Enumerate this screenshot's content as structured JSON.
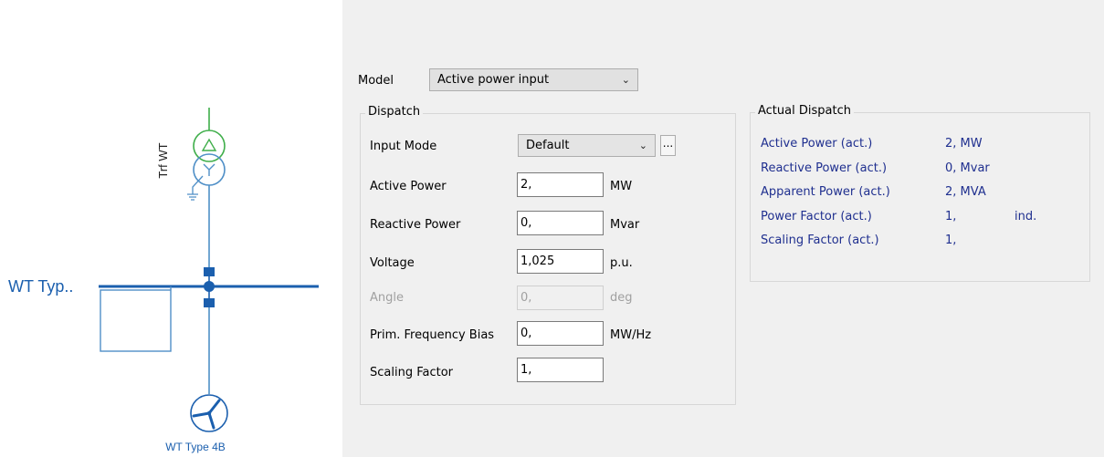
{
  "diagram": {
    "transformer_label": "Trf WT",
    "busbar_label": "WT Typ..",
    "generator_label": "WT Type 4B",
    "colors": {
      "line": "#4f8fc7",
      "busbar": "#1b5fae",
      "transformer_hv": "#3fae4a",
      "transformer_lv": "#4f8fc7"
    }
  },
  "model": {
    "label": "Model",
    "value": "Active power input"
  },
  "dispatch": {
    "title": "Dispatch",
    "input_mode": {
      "label": "Input Mode",
      "value": "Default",
      "browse": "..."
    },
    "active_power": {
      "label": "Active Power",
      "value": "2,",
      "unit": "MW"
    },
    "reactive_power": {
      "label": "Reactive Power",
      "value": "0,",
      "unit": "Mvar"
    },
    "voltage": {
      "label": "Voltage",
      "value": "1,025",
      "unit": "p.u."
    },
    "angle": {
      "label": "Angle",
      "value": "0,",
      "unit": "deg"
    },
    "freq_bias": {
      "label": "Prim. Frequency Bias",
      "value": "0,",
      "unit": "MW/Hz"
    },
    "scaling": {
      "label": "Scaling Factor",
      "value": "1,"
    }
  },
  "actual": {
    "title": "Actual Dispatch",
    "rows": [
      {
        "label": "Active Power (act.)",
        "value": "2, MW",
        "extra": ""
      },
      {
        "label": "Reactive Power (act.)",
        "value": "0, Mvar",
        "extra": ""
      },
      {
        "label": "Apparent Power (act.)",
        "value": "2, MVA",
        "extra": ""
      },
      {
        "label": "Power Factor (act.)",
        "value": "1,",
        "extra": "ind."
      },
      {
        "label": "Scaling Factor (act.)",
        "value": "1,",
        "extra": ""
      }
    ]
  }
}
